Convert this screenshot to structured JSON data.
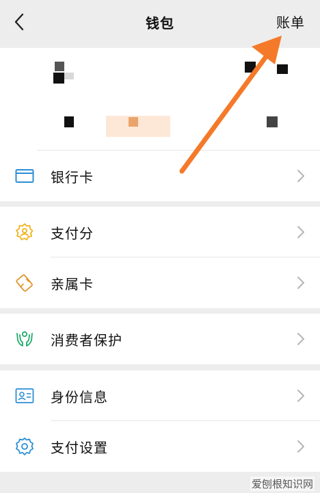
{
  "header": {
    "title": "钱包",
    "bill_label": "账单",
    "back_icon": "chevron-left-icon"
  },
  "menu": {
    "group1": [
      {
        "label": "银行卡",
        "icon": "bank-card-icon",
        "color": "#2b8fd6"
      }
    ],
    "group2": [
      {
        "label": "支付分",
        "icon": "pay-score-icon",
        "color": "#f2b21a"
      },
      {
        "label": "亲属卡",
        "icon": "family-card-icon",
        "color": "#e0962c"
      }
    ],
    "group3": [
      {
        "label": "消费者保护",
        "icon": "consumer-protection-icon",
        "color": "#1faa6b"
      }
    ],
    "group4": [
      {
        "label": "身份信息",
        "icon": "id-card-icon",
        "color": "#2b8fd6"
      },
      {
        "label": "支付设置",
        "icon": "settings-gear-icon",
        "color": "#2b8fd6"
      }
    ]
  },
  "annotation": {
    "arrow_color": "#f47a2a"
  },
  "watermark": {
    "text": "爱刨根知识网"
  }
}
